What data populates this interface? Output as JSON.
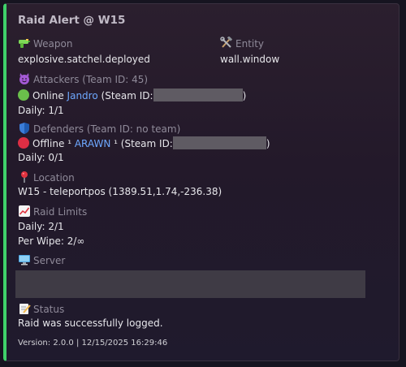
{
  "embed": {
    "title": "Raid Alert @ W15",
    "accent_color": "#3fd16a"
  },
  "weapon": {
    "icon": "water-pistol-icon",
    "label": "Weapon",
    "value": "explosive.satchel.deployed"
  },
  "entity": {
    "icon": "hammer-wrench-icon",
    "label": "Entity",
    "value": "wall.window"
  },
  "attackers": {
    "icon": "smiling-devil-icon",
    "label": "Attackers (Team ID: 45)",
    "status_icon": "green-circle-icon",
    "status": "Online",
    "player": "Jandro",
    "steam_prefix": "(Steam ID:",
    "steam_suffix": ")",
    "daily": "Daily: 1/1"
  },
  "defenders": {
    "icon": "shield-icon",
    "label": "Defenders (Team ID: no team)",
    "status_icon": "red-circle-icon",
    "status": "Offline",
    "player_prefix": "¹",
    "player": "ARAWN",
    "player_suffix": "¹",
    "steam_prefix": "(Steam ID:",
    "steam_suffix": ")",
    "daily": "Daily: 0/1"
  },
  "location": {
    "icon": "round-pushpin-icon",
    "label": "Location",
    "value": "W15 - teleportpos (1389.51,1.74,-236.38)"
  },
  "raid_limits": {
    "icon": "chart-increasing-icon",
    "label": "Raid Limits",
    "daily": "Daily: 2/1",
    "per_wipe": "Per Wipe: 2/∞"
  },
  "server": {
    "icon": "desktop-computer-icon",
    "label": "Server"
  },
  "status": {
    "icon": "memo-icon",
    "label": "Status",
    "value": "Raid was successfully logged."
  },
  "footer": "Version: 2.0.0 | 12/15/2025 16:29:46"
}
